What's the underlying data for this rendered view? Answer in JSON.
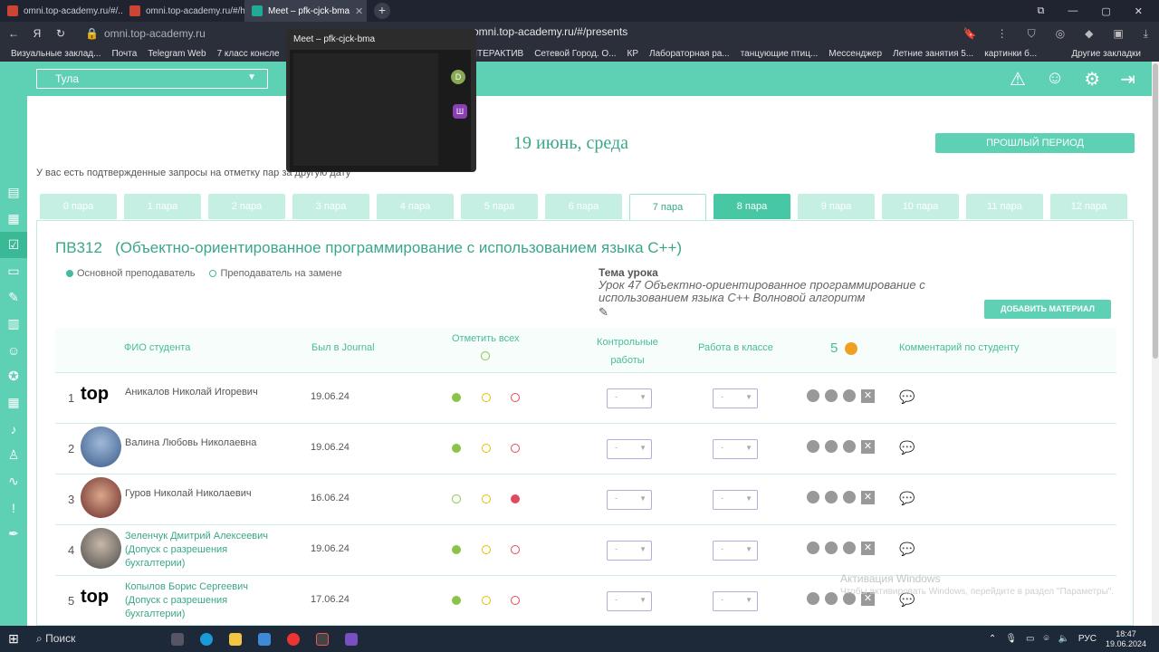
{
  "browser": {
    "tabs": [
      {
        "label": "omni.top-academy.ru/#/...",
        "active": false
      },
      {
        "label": "omni.top-academy.ru/#/h...",
        "active": false
      },
      {
        "label": "Meet – pfk-cjck-bma",
        "active": true
      }
    ],
    "address": "omni.top-academy.ru",
    "address_tail": "omni.top-academy.ru/#/presents",
    "bookmarks": [
      "Визуальные заклад...",
      "Почта",
      "Telegram Web",
      "7 класс консле",
      "ИНТЕРАКТИВ",
      "Сетевой Город. О...",
      "КР",
      "Лабораторная ра...",
      "танцующие птиц...",
      "Мессенджер",
      "Летние занятия 5...",
      "картинки б..."
    ],
    "other_bookmarks": "Другие закладки",
    "meet_preview_title": "Meet – pfk-cjck-bma",
    "meet_avatar_1": "D",
    "meet_avatar_2": "Ш"
  },
  "app": {
    "city": "Тула",
    "date": "19 июнь, среда",
    "past_period": "ПРОШЛЫЙ ПЕРИОД",
    "notice": "У вас есть подтвержденные запросы на отметку пар за другую дату",
    "pairs": [
      "0 пара",
      "1 пара",
      "2 пара",
      "3 пара",
      "4 пара",
      "5 пара",
      "6 пара",
      "7 пара",
      "8 пара",
      "9 пара",
      "10 пара",
      "11 пара",
      "12 пара"
    ],
    "active_pair": "7 пара",
    "group": "ПВ312",
    "subject": "(Объектно-ориентированное программирование с использованием языка С++)",
    "legend_main": "Основной преподаватель",
    "legend_sub": "Преподаватель на замене",
    "topic_heading": "Тема урока",
    "topic_text": "Урок 47 Объектно-ориентированное программирование с использованием языка С++ Волновой алгоритм",
    "add_material": "ДОБАВИТЬ МАТЕРИАЛ",
    "columns": {
      "name": "ФИО студента",
      "was": "Был в Journal",
      "mark_all": "Отметить всех",
      "tests": "Контрольные работы",
      "classwork": "Работа в классе",
      "coins": "5",
      "comment": "Комментарий по студенту"
    },
    "students": [
      {
        "n": "1",
        "name": "Аникалов Николай Игоревич",
        "was": "19.06.24",
        "photo": "top",
        "linked": false
      },
      {
        "n": "2",
        "name": "Валина Любовь Николаевна",
        "was": "19.06.24",
        "photo": "face",
        "linked": false
      },
      {
        "n": "3",
        "name": "Гуров Николай Николаевич",
        "was": "16.06.24",
        "photo": "face",
        "linked": false
      },
      {
        "n": "4",
        "name": "Зеленчук Дмитрий Алексеевич (Допуск с разрешения бухгалтерии)",
        "was": "19.06.24",
        "photo": "face",
        "linked": true
      },
      {
        "n": "5",
        "name": "Копылов Борис Сергеевич (Допуск с разрешения бухгалтерии)",
        "was": "17.06.24",
        "photo": "top",
        "linked": true
      }
    ],
    "select_placeholder": "-",
    "logo_text": "top"
  },
  "watermark": {
    "line1": "Активация Windows",
    "line2": "Чтобы активировать Windows, перейдите в раздел \"Параметры\"."
  },
  "taskbar": {
    "search": "Поиск",
    "lang": "РУС",
    "time": "18:47",
    "date": "19.06.2024"
  },
  "colors": {
    "accent": "#5ed0b3",
    "accent_dark": "#3aa68a",
    "present": "#8bc34a",
    "late": "#f0d000",
    "absent": "#e04a5c"
  }
}
